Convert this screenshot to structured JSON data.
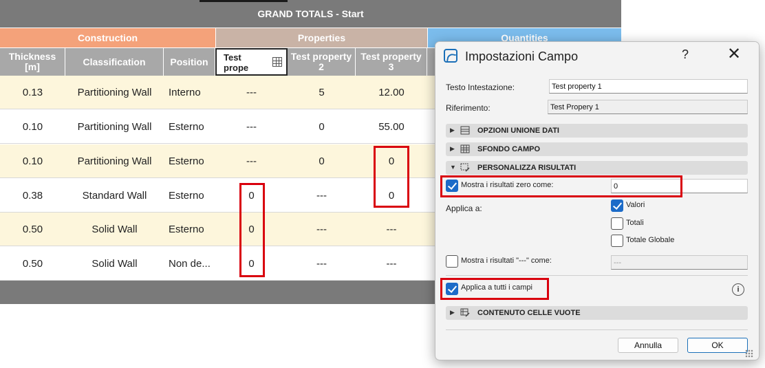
{
  "schedule": {
    "grand_title": "GRAND TOTALS - Start",
    "groups": {
      "construction": "Construction",
      "properties": "Properties",
      "quantities": "Quantities"
    },
    "colors": {
      "construction": "#f4a27a",
      "properties": "#c9b3a6",
      "quantities": "#7bbcec"
    },
    "headers": {
      "thickness": "Thickness\n[m]",
      "classification": "Classification",
      "position": "Position",
      "test1": "Test\nprope",
      "test2": "Test property\n2",
      "test3": "Test property\n3"
    },
    "rows": [
      {
        "thickness": "0.13",
        "classification": "Partitioning Wall",
        "position": "Interno",
        "p1": "---",
        "p2": "5",
        "p3": "12.00"
      },
      {
        "thickness": "0.10",
        "classification": "Partitioning Wall",
        "position": "Esterno",
        "p1": "---",
        "p2": "0",
        "p3": "55.00"
      },
      {
        "thickness": "0.10",
        "classification": "Partitioning Wall",
        "position": "Esterno",
        "p1": "---",
        "p2": "0",
        "p3": "0"
      },
      {
        "thickness": "0.38",
        "classification": "Standard Wall",
        "position": "Esterno",
        "p1": "0",
        "p2": "---",
        "p3": "0"
      },
      {
        "thickness": "0.50",
        "classification": "Solid Wall",
        "position": "Esterno",
        "p1": "0",
        "p2": "---",
        "p3": "---"
      },
      {
        "thickness": "0.50",
        "classification": "Solid Wall",
        "position": "Non de...",
        "p1": "0",
        "p2": "---",
        "p3": "---"
      }
    ]
  },
  "dialog": {
    "title": "Impostazioni Campo",
    "help": "?",
    "close": "✕",
    "header_text_label": "Testo Intestazione:",
    "header_text_value": "Test property 1",
    "reference_label": "Riferimento:",
    "reference_value": "Test Propery 1",
    "sections": {
      "merge": "OPZIONI UNIONE DATI",
      "background": "SFONDO CAMPO",
      "customize": "PERSONALIZZA RISULTATI",
      "empty": "CONTENUTO CELLE VUOTE"
    },
    "show_zero_label": "Mostra i risultati zero come:",
    "show_zero_value": "0",
    "show_zero_checked": true,
    "apply_to_label": "Applica a:",
    "apply_options": [
      {
        "label": "Valori",
        "checked": true
      },
      {
        "label": "Totali",
        "checked": false
      },
      {
        "label": "Totale Globale",
        "checked": false
      }
    ],
    "show_dash_label": "Mostra i risultati \"---\" come:",
    "show_dash_value": "---",
    "show_dash_checked": false,
    "apply_all_label": "Applica a tutti i campi",
    "apply_all_checked": true,
    "cancel_label": "Annulla",
    "ok_label": "OK"
  },
  "highlight_color": "#d9000d"
}
